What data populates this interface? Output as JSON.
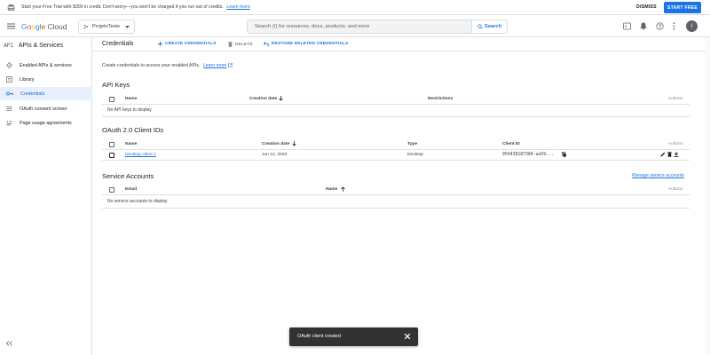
{
  "banner": {
    "message": "Start your Free Trial with $300 in credit. Don't worry—you won't be charged if you run out of credits.",
    "learn_more": "Learn more",
    "dismiss": "DISMISS",
    "start_free": "START FREE"
  },
  "header": {
    "logo_google": [
      "G",
      "o",
      "o",
      "g",
      "l",
      "e"
    ],
    "logo_cloud": "Cloud",
    "project_name": "ProjetoTeste",
    "search_placeholder": "Search (/) for resources, docs, products, and more",
    "search_button": "Search",
    "avatar_letter": "I"
  },
  "sidebar": {
    "product_icon_text": "API",
    "product_title": "APIs & Services",
    "items": [
      {
        "label": "Enabled APIs & services",
        "icon": "diamond-icon"
      },
      {
        "label": "Library",
        "icon": "library-icon"
      },
      {
        "label": "Credentials",
        "icon": "key-icon",
        "active": true
      },
      {
        "label": "OAuth consent screen",
        "icon": "consent-icon"
      },
      {
        "label": "Page usage agreements",
        "icon": "settings-list-icon"
      }
    ]
  },
  "actionbar": {
    "title": "Credentials",
    "create": "CREATE CREDENTIALS",
    "delete": "DELETE",
    "restore": "RESTORE DELETED CREDENTIALS"
  },
  "intro": {
    "text": "Create credentials to access your enabled APIs.",
    "learn_more": "Learn more"
  },
  "api_keys": {
    "title": "API Keys",
    "columns": [
      "Name",
      "Creation date",
      "Restrictions",
      "Actions"
    ],
    "empty": "No API keys to display"
  },
  "oauth": {
    "title": "OAuth 2.0 Client IDs",
    "columns": [
      "Name",
      "Creation date",
      "Type",
      "Client ID",
      "Actions"
    ],
    "rows": [
      {
        "name": "Desktop client 1",
        "date": "Jun 12, 2023",
        "type": "Desktop",
        "client_id": "954438187384-ua59..."
      }
    ]
  },
  "service_accounts": {
    "title": "Service Accounts",
    "manage": "Manage service accounts",
    "columns": [
      "Email",
      "Name",
      "Actions"
    ],
    "empty": "No service accounts to display"
  },
  "snackbar": {
    "text": "OAuth client created"
  },
  "colors": {
    "accent": "#1a73e8",
    "active_nav_bg": "#e8f0fe",
    "snackbar_bg": "#323232"
  }
}
